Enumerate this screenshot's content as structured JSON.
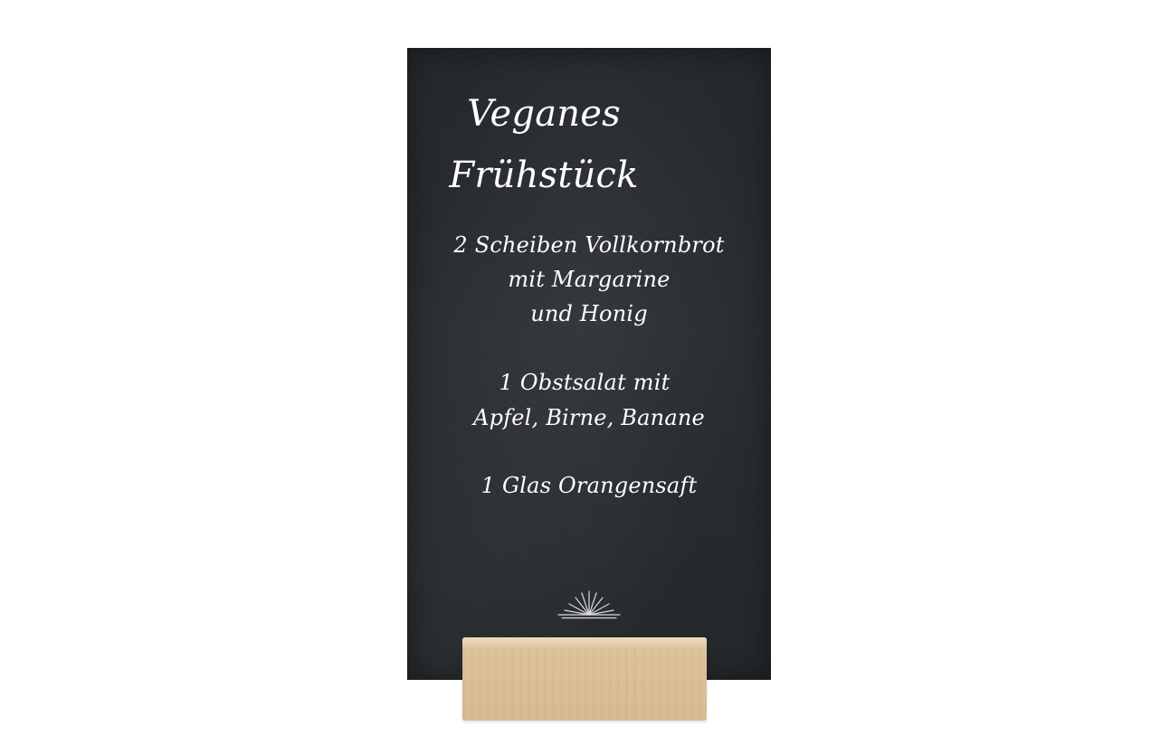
{
  "sign": {
    "title_line1": "Veganes",
    "title_line2": "Frühstück",
    "items": [
      "2 Scheiben Vollkornbrot",
      "mit Margarine",
      "und Honig",
      "1 Obstsalat mit",
      "Apfel, Birne, Banane",
      "1 Glas Orangensaft"
    ],
    "ornament_icon": "sunburst-icon",
    "colors": {
      "board": "#25282b",
      "text": "#ffffff",
      "stand": "#d8bb92"
    }
  }
}
